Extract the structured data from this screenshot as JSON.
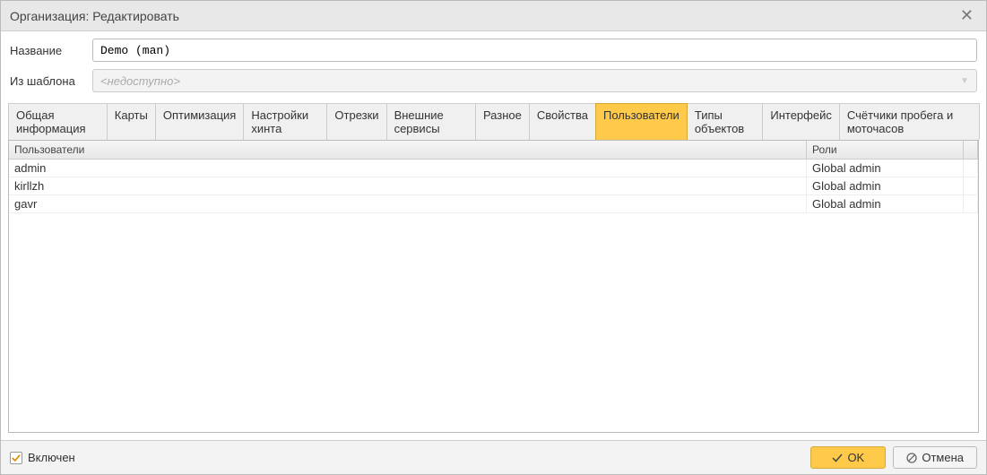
{
  "window": {
    "title": "Организация: Редактировать"
  },
  "form": {
    "name_label": "Название",
    "name_value": "Demo (man)",
    "template_label": "Из шаблона",
    "template_value": "<недоступно>"
  },
  "tabs": [
    {
      "label": "Общая информация"
    },
    {
      "label": "Карты"
    },
    {
      "label": "Оптимизация"
    },
    {
      "label": "Настройки хинта"
    },
    {
      "label": "Отрезки"
    },
    {
      "label": "Внешние сервисы"
    },
    {
      "label": "Разное"
    },
    {
      "label": "Свойства"
    },
    {
      "label": "Пользователи"
    },
    {
      "label": "Типы объектов"
    },
    {
      "label": "Интерфейс"
    },
    {
      "label": "Счётчики пробега и моточасов"
    }
  ],
  "active_tab_index": 8,
  "grid": {
    "header_user": "Пользователи",
    "header_role": "Роли",
    "rows": [
      {
        "user": "admin",
        "role": "Global admin"
      },
      {
        "user": "kirllzh",
        "role": "Global admin"
      },
      {
        "user": "gavr",
        "role": "Global admin"
      }
    ]
  },
  "footer": {
    "enabled_label": "Включен",
    "ok_label": "OK",
    "cancel_label": "Отмена"
  }
}
